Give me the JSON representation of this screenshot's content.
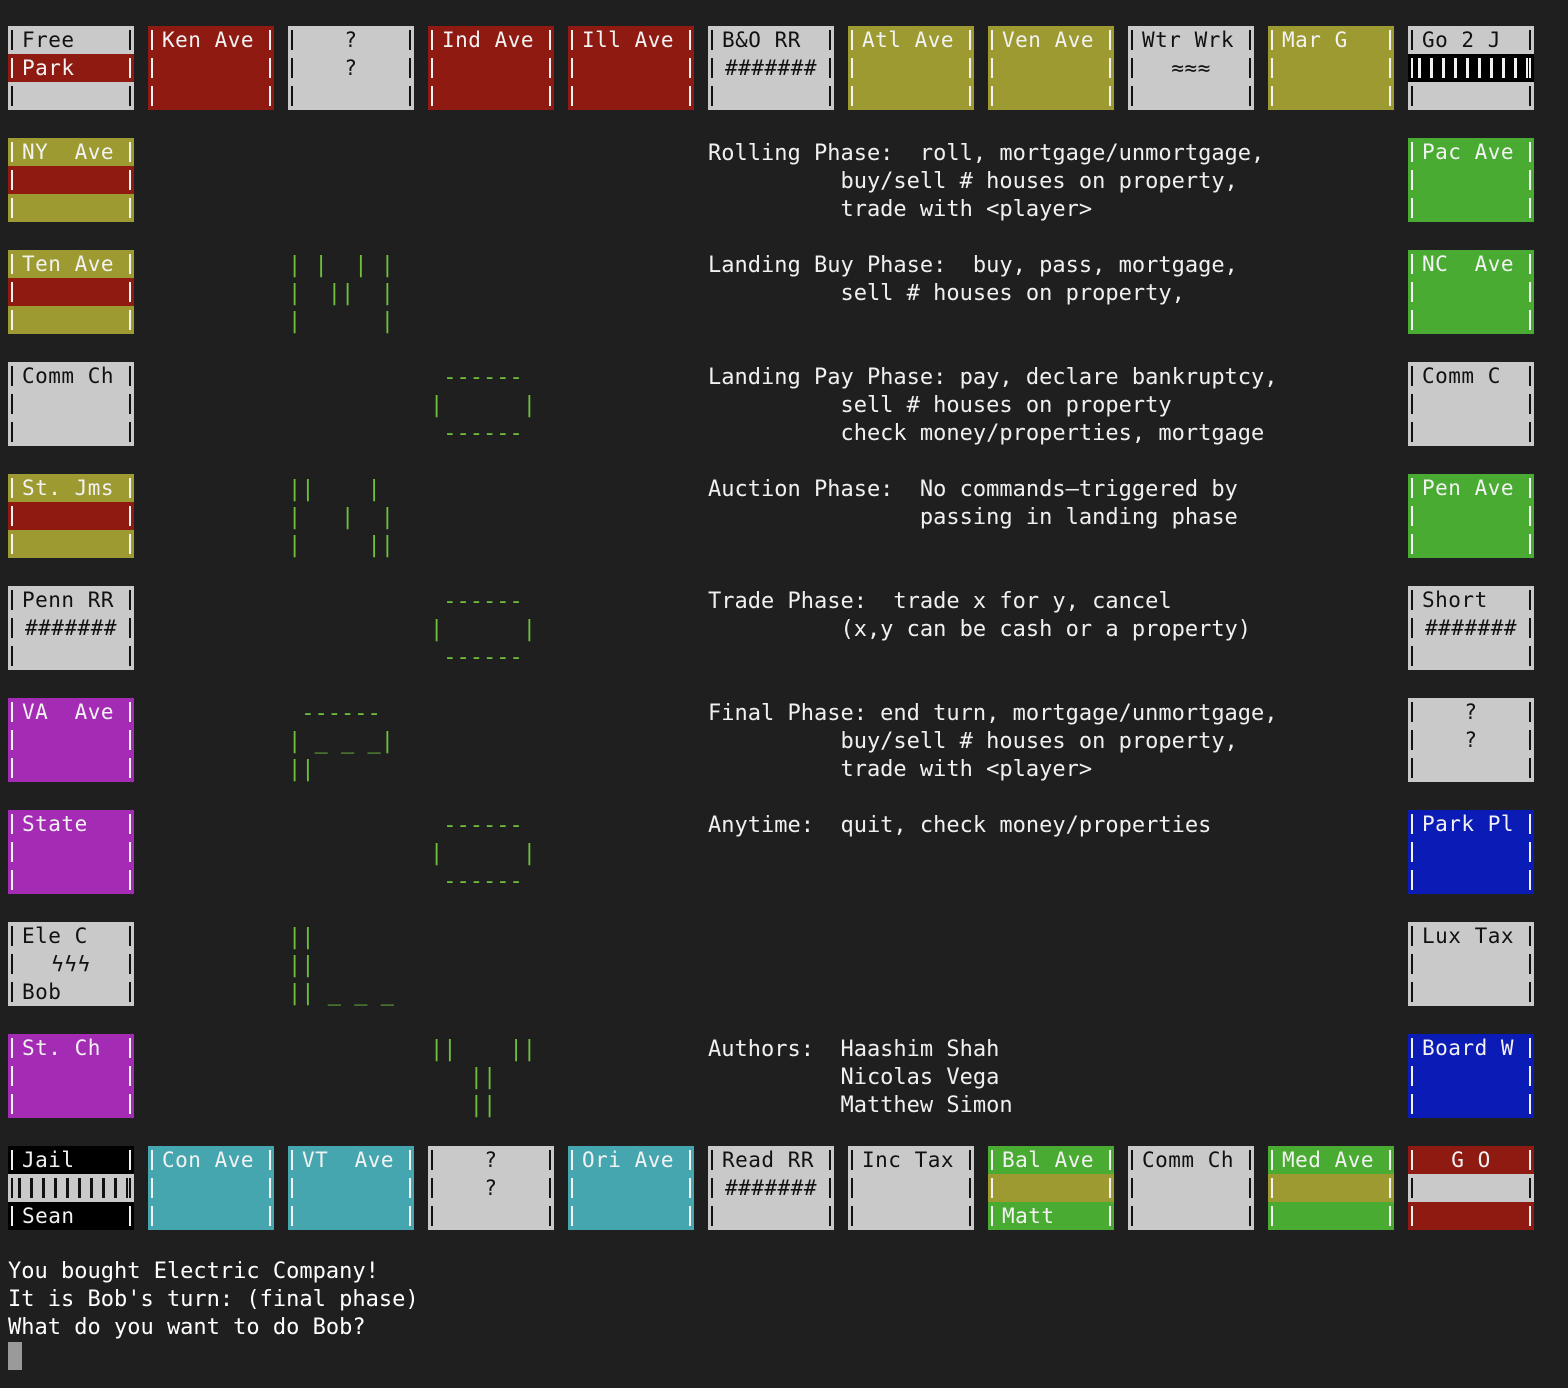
{
  "colors": {
    "background": "#1f1f1f",
    "gray": "#c9c9c9",
    "red": "#8e1a12",
    "olive": "#9c9a30",
    "green": "#4aab32",
    "purple": "#a42bb4",
    "teal": "#46a6b0",
    "blue": "#0b1bb5",
    "black": "#000000",
    "text_dark": "#111111",
    "text_light": "#f2f2f2"
  },
  "board": {
    "top": [
      {
        "rows": [
          "Free",
          "Park",
          ""
        ],
        "bg": [
          "gray",
          "red",
          "gray"
        ]
      },
      {
        "rows": [
          "Ken Ave",
          "",
          ""
        ],
        "bg": [
          "red",
          "red",
          "red"
        ]
      },
      {
        "rows": [
          "?",
          "?",
          ""
        ],
        "bg": [
          "gray",
          "gray",
          "gray"
        ],
        "center": true
      },
      {
        "rows": [
          "Ind Ave",
          "",
          ""
        ],
        "bg": [
          "red",
          "red",
          "red"
        ]
      },
      {
        "rows": [
          "Ill Ave",
          "",
          ""
        ],
        "bg": [
          "red",
          "red",
          "red"
        ]
      },
      {
        "rows": [
          "B&O RR",
          "#######",
          ""
        ],
        "bg": [
          "gray",
          "gray",
          "gray"
        ]
      },
      {
        "rows": [
          "Atl Ave",
          "",
          ""
        ],
        "bg": [
          "olive",
          "olive",
          "olive"
        ]
      },
      {
        "rows": [
          "Ven Ave",
          "",
          ""
        ],
        "bg": [
          "olive",
          "olive",
          "olive"
        ]
      },
      {
        "rows": [
          "Wtr Wrk",
          "≈≈≈",
          ""
        ],
        "bg": [
          "gray",
          "gray",
          "gray"
        ]
      },
      {
        "rows": [
          "Mar G",
          "",
          ""
        ],
        "bg": [
          "olive",
          "olive",
          "olive"
        ]
      },
      {
        "rows": [
          "Go 2 J",
          "||||||||",
          ""
        ],
        "bg": [
          "gray",
          "black",
          "gray"
        ]
      }
    ],
    "left": [
      {
        "rows": [
          "NY  Ave",
          "",
          ""
        ],
        "bg": [
          "olive",
          "red",
          "olive"
        ]
      },
      {
        "rows": [
          "Ten Ave",
          "",
          ""
        ],
        "bg": [
          "olive",
          "red",
          "olive"
        ]
      },
      {
        "rows": [
          "Comm Ch",
          "",
          ""
        ],
        "bg": [
          "gray",
          "gray",
          "gray"
        ]
      },
      {
        "rows": [
          "St. Jms",
          "",
          ""
        ],
        "bg": [
          "olive",
          "red",
          "olive"
        ]
      },
      {
        "rows": [
          "Penn RR",
          "#######",
          ""
        ],
        "bg": [
          "gray",
          "gray",
          "gray"
        ]
      },
      {
        "rows": [
          "VA  Ave",
          "",
          ""
        ],
        "bg": [
          "purple",
          "purple",
          "purple"
        ]
      },
      {
        "rows": [
          "State",
          "",
          ""
        ],
        "bg": [
          "purple",
          "purple",
          "purple"
        ]
      },
      {
        "rows": [
          "Ele C",
          "ϟϟϟ",
          "Bob"
        ],
        "bg": [
          "gray",
          "gray",
          "gray"
        ]
      },
      {
        "rows": [
          "St. Ch",
          "",
          ""
        ],
        "bg": [
          "purple",
          "purple",
          "purple"
        ]
      }
    ],
    "right": [
      {
        "rows": [
          "Pac Ave",
          "",
          ""
        ],
        "bg": [
          "green",
          "green",
          "green"
        ]
      },
      {
        "rows": [
          "NC  Ave",
          "",
          ""
        ],
        "bg": [
          "green",
          "green",
          "green"
        ]
      },
      {
        "rows": [
          "Comm C",
          "",
          ""
        ],
        "bg": [
          "gray",
          "gray",
          "gray"
        ]
      },
      {
        "rows": [
          "Pen Ave",
          "",
          ""
        ],
        "bg": [
          "green",
          "green",
          "green"
        ]
      },
      {
        "rows": [
          "Short",
          "#######",
          ""
        ],
        "bg": [
          "gray",
          "gray",
          "gray"
        ]
      },
      {
        "rows": [
          "?",
          "?",
          ""
        ],
        "bg": [
          "gray",
          "gray",
          "gray"
        ],
        "center": true
      },
      {
        "rows": [
          "Park Pl",
          "",
          ""
        ],
        "bg": [
          "blue",
          "blue",
          "blue"
        ]
      },
      {
        "rows": [
          "Lux Tax",
          "",
          ""
        ],
        "bg": [
          "gray",
          "gray",
          "gray"
        ]
      },
      {
        "rows": [
          "Board W",
          "",
          ""
        ],
        "bg": [
          "blue",
          "blue",
          "blue"
        ]
      }
    ],
    "bottom": [
      {
        "rows": [
          "Jail",
          "||||||||",
          "Sean"
        ],
        "bg": [
          "black",
          "gray",
          "black"
        ]
      },
      {
        "rows": [
          "Con Ave",
          "",
          ""
        ],
        "bg": [
          "teal",
          "teal",
          "teal"
        ]
      },
      {
        "rows": [
          "VT  Ave",
          "",
          ""
        ],
        "bg": [
          "teal",
          "teal",
          "teal"
        ]
      },
      {
        "rows": [
          "?",
          "?",
          ""
        ],
        "bg": [
          "gray",
          "gray",
          "gray"
        ],
        "center": true
      },
      {
        "rows": [
          "Ori Ave",
          "",
          ""
        ],
        "bg": [
          "teal",
          "teal",
          "teal"
        ]
      },
      {
        "rows": [
          "Read RR",
          "#######",
          ""
        ],
        "bg": [
          "gray",
          "gray",
          "gray"
        ]
      },
      {
        "rows": [
          "Inc Tax",
          "",
          ""
        ],
        "bg": [
          "gray",
          "gray",
          "gray"
        ]
      },
      {
        "rows": [
          "Bal Ave",
          "",
          "Matt"
        ],
        "bg": [
          "green",
          "olive",
          "green"
        ]
      },
      {
        "rows": [
          "Comm Ch",
          "",
          ""
        ],
        "bg": [
          "gray",
          "gray",
          "gray"
        ]
      },
      {
        "rows": [
          "Med Ave",
          "",
          ""
        ],
        "bg": [
          "green",
          "olive",
          "green"
        ]
      },
      {
        "rows": [
          "G O",
          "",
          ""
        ],
        "bg": [
          "red",
          "gray",
          "red"
        ],
        "center": true
      }
    ]
  },
  "help": {
    "rolling": "Rolling Phase:  roll, mortgage/unmortgage,\n          buy/sell # houses on property,\n          trade with <player>",
    "landing_buy": "Landing Buy Phase:  buy, pass, mortgage,\n          sell # houses on property,",
    "landing_pay": "Landing Pay Phase: pay, declare bankruptcy,\n          sell # houses on property\n          check money/properties, mortgage",
    "auction": "Auction Phase:  No commands—triggered by\n                passing in landing phase",
    "trade": "Trade Phase:  trade x for y, cancel\n          (x,y can be cash or a property)",
    "final": "Final Phase: end turn, mortgage/unmortgage,\n          buy/sell # houses on property,\n          trade with <player>",
    "anytime": "Anytime:  quit, check money/properties",
    "authors": "Authors:  Haashim Shah\n          Nicolas Vega\n          Matthew Simon"
  },
  "console": {
    "line1": "You bought Electric Company!",
    "line2": "It is Bob's turn: (final phase)",
    "line3": "What do you want to do Bob?"
  }
}
